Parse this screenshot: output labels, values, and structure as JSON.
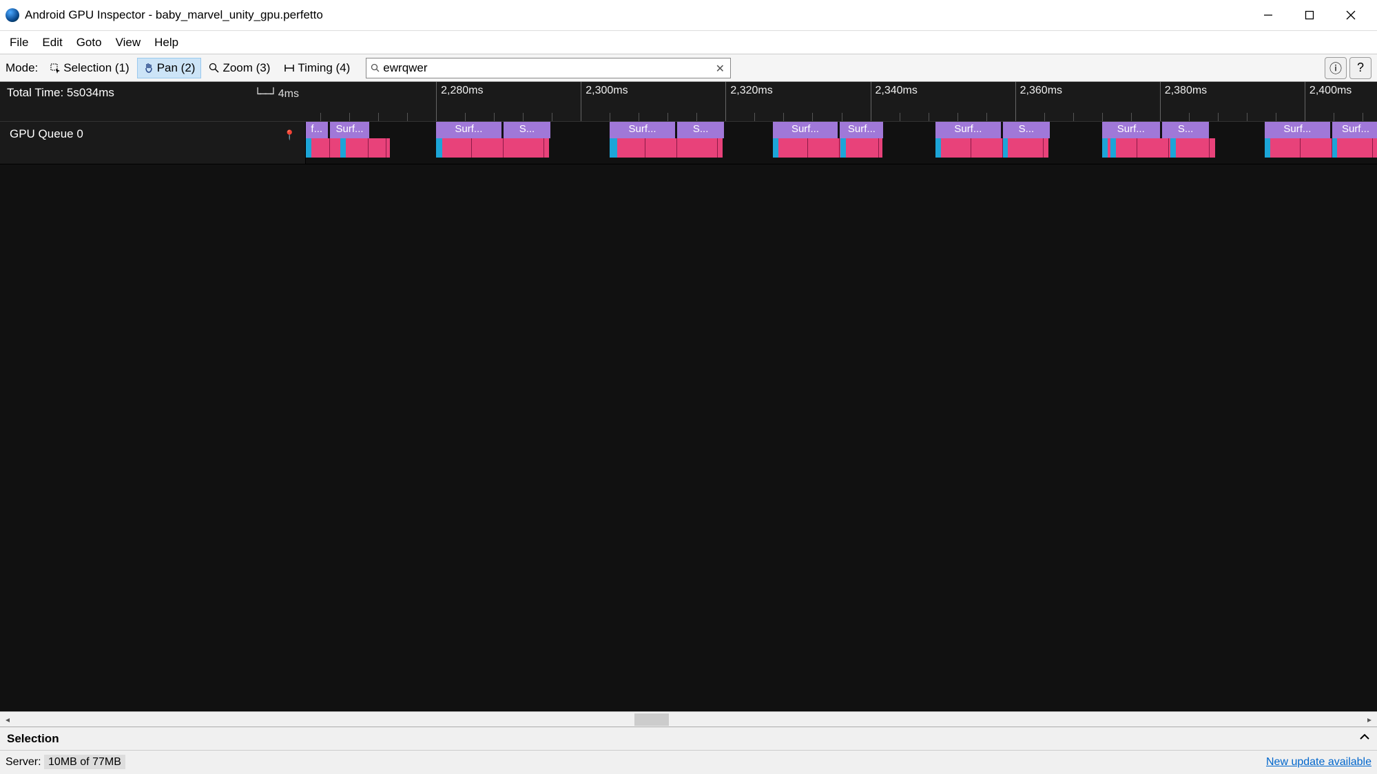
{
  "titlebar": {
    "text": "Android GPU Inspector - baby_marvel_unity_gpu.perfetto"
  },
  "menu": {
    "items": [
      "File",
      "Edit",
      "Goto",
      "View",
      "Help"
    ]
  },
  "toolbar": {
    "mode_label": "Mode:",
    "modes": [
      {
        "label": "Selection (1)",
        "icon": "selection",
        "active": false
      },
      {
        "label": "Pan (2)",
        "icon": "pan",
        "active": true
      },
      {
        "label": "Zoom (3)",
        "icon": "zoom",
        "active": false
      },
      {
        "label": "Timing (4)",
        "icon": "timing",
        "active": false
      }
    ],
    "search_value": "ewrqwer"
  },
  "timeline": {
    "total_time_label": "Total Time: 5s034ms",
    "scale_label": "4ms",
    "view_start_ms": 2262,
    "view_end_ms": 2410,
    "major_ticks": [
      "2,280ms",
      "2,300ms",
      "2,320ms",
      "2,340ms",
      "2,360ms",
      "2,380ms",
      "2,400ms"
    ]
  },
  "track": {
    "label": "GPU Queue 0",
    "groups": [
      {
        "start": 2262,
        "purple": [
          {
            "w": 3,
            "label": "f..."
          },
          {
            "w": 5.5,
            "label": "Surf..."
          }
        ],
        "pink_w": 11.6,
        "blue": [
          {
            "off": 0,
            "w": 0.5
          },
          {
            "off": 4.8,
            "w": 0.6
          }
        ],
        "div": [
          3.2,
          8.6,
          11.0
        ]
      },
      {
        "start": 2280,
        "purple": [
          {
            "w": 9,
            "label": "Surf..."
          },
          {
            "w": 6.5,
            "label": "S..."
          }
        ],
        "pink_w": 15.6,
        "blue": [
          {
            "off": 0,
            "w": 0.8
          }
        ],
        "div": [
          4.8,
          9.2,
          14.8
        ]
      },
      {
        "start": 2304,
        "purple": [
          {
            "w": 9,
            "label": "Surf..."
          },
          {
            "w": 6.5,
            "label": "S..."
          }
        ],
        "pink_w": 15.6,
        "blue": [
          {
            "off": 0,
            "w": 1.0
          }
        ],
        "div": [
          4.8,
          9.2,
          14.8
        ]
      },
      {
        "start": 2326.5,
        "purple": [
          {
            "w": 9,
            "label": "Surf..."
          },
          {
            "w": 6,
            "label": "Surf..."
          }
        ],
        "pink_w": 15.2,
        "blue": [
          {
            "off": 0,
            "w": 0.6
          },
          {
            "off": 9.4,
            "w": 0.4
          }
        ],
        "div": [
          4.8,
          9.2,
          14.6
        ]
      },
      {
        "start": 2349,
        "purple": [
          {
            "w": 9,
            "label": "Surf..."
          },
          {
            "w": 6.5,
            "label": "S..."
          }
        ],
        "pink_w": 15.6,
        "blue": [
          {
            "off": 0,
            "w": 0.6
          },
          {
            "off": 9.2,
            "w": 0.4
          }
        ],
        "div": [
          4.8,
          9.2,
          14.8
        ]
      },
      {
        "start": 2372,
        "purple": [
          {
            "w": 8,
            "label": "Surf..."
          },
          {
            "w": 6.5,
            "label": "S..."
          }
        ],
        "pink_w": 15.6,
        "blue": [
          {
            "off": 0,
            "w": 0.5
          },
          {
            "off": 1.2,
            "w": 0.5
          },
          {
            "off": 9.4,
            "w": 0.4
          }
        ],
        "div": [
          4.8,
          9.2,
          14.8
        ]
      },
      {
        "start": 2394.5,
        "purple": [
          {
            "w": 9,
            "label": "Surf..."
          },
          {
            "w": 6.5,
            "label": "Surf..."
          }
        ],
        "pink_w": 15.6,
        "blue": [
          {
            "off": 0,
            "w": 0.6
          },
          {
            "off": 9.2,
            "w": 0.4
          }
        ],
        "div": [
          4.8,
          9.2,
          14.8
        ]
      }
    ]
  },
  "bottom": {
    "panel_title": "Selection",
    "server_label": "Server:",
    "server_mem": "10MB of 77MB",
    "update_text": "New update available"
  }
}
